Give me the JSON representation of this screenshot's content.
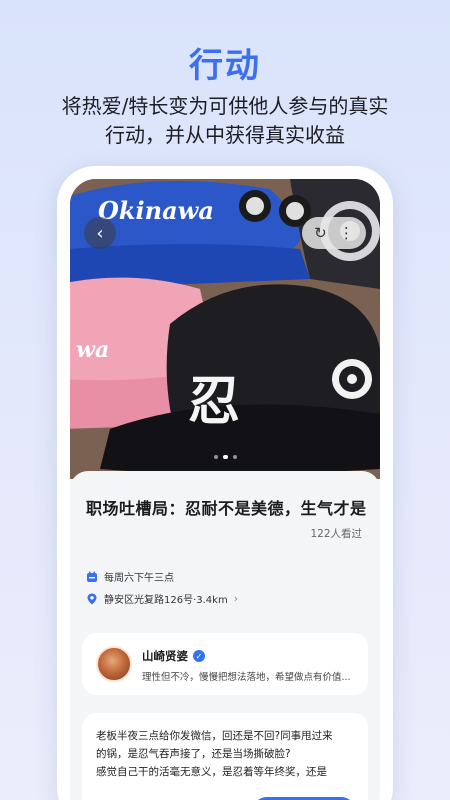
{
  "headline": "行动",
  "subhead": {
    "line1": "将热爱/特长变为可供他人参与的真实",
    "line2": "行动，并从中获得真实收益"
  },
  "hero": {
    "back_icon": "chevron-left-icon",
    "share_icon": "share-icon",
    "more_icon": "more-vertical-icon",
    "image_desc_words": [
      "Okinawa",
      "忍"
    ],
    "carousel": {
      "count": 3,
      "active": 1
    }
  },
  "event": {
    "title": "职场吐槽局：忍耐不是美德，生气才是",
    "views": "122人看过",
    "time": "每周六下午三点",
    "location": "静安区光复路126号·3.4km"
  },
  "author": {
    "name": "山崎贤婆",
    "bio": "理性但不冷，慢慢把想法落地，希望做点有价值..."
  },
  "description": {
    "lines": [
      "老板半夜三点给你发微信，回还是不回?同事甩过来",
      "的锅，是忍气吞声接了，还是当场撕破脸?",
      "感觉自己干的活毫无意义，是忍着等年终奖，还是"
    ]
  },
  "colors": {
    "accent": "#3b6ff2",
    "verified": "#2f74f5"
  }
}
